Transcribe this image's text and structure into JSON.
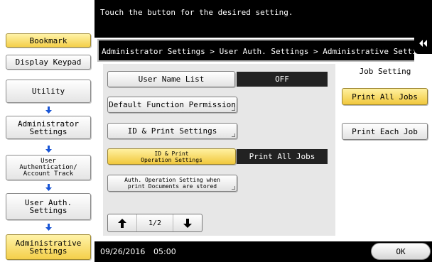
{
  "instruction": "Touch the button for the desired setting.",
  "breadcrumb": "Administrator Settings > User Auth. Settings > Administrative Settings",
  "left_menu": {
    "bookmark": "Bookmark",
    "display_keypad": "Display Keypad",
    "utility": "Utility",
    "administrator_settings": "Administrator\nSettings",
    "user_auth_account_track": "User\nAuthentication/\nAccount Track",
    "user_auth_settings": "User Auth.\nSettings",
    "administrative_settings": "Administrative\nSettings"
  },
  "settings": {
    "user_name_list": {
      "label": "User Name List",
      "value": "OFF"
    },
    "default_function_permission": {
      "label": "Default Function Permission"
    },
    "id_print_settings": {
      "label": "ID & Print Settings"
    },
    "id_print_operation_settings": {
      "label": "ID & Print\nOperation Settings",
      "value": "Print All Jobs"
    },
    "auth_operation_setting": {
      "label": "Auth. Operation Setting when\nprint Documents are stored"
    }
  },
  "pager": {
    "current": "1/2"
  },
  "job_setting": {
    "header": "Job Setting",
    "options": [
      "Print All Jobs",
      "Print Each Job"
    ],
    "selected": "Print All Jobs"
  },
  "status": {
    "date": "09/26/2016",
    "time": "05:00"
  },
  "ok_label": "OK",
  "colors": {
    "accent_yellow": "#f4cf4a",
    "arrow_blue": "#1a56d6",
    "panel_gray": "#e7e7e7"
  }
}
